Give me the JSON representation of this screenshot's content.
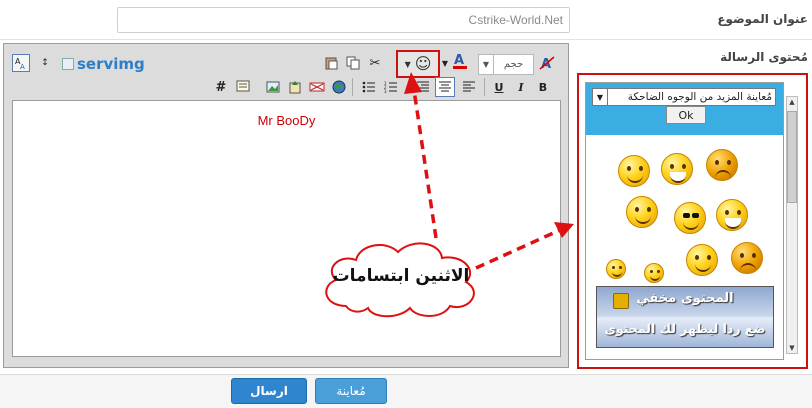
{
  "form": {
    "subject_label": "عنوان الموضوع",
    "subject_value": "Cstrike-World.Net",
    "message_label": "مُحتوى الرسالة"
  },
  "toolbar": {
    "servimg_label": "servimg",
    "size_select_value": "حجم",
    "row1_icons": [
      "font-size-toggle-icon",
      "expand-icon",
      "servimg-icon",
      "paste-icon",
      "copy-icon",
      "cut-icon",
      "smiley-icon",
      "font-color-icon",
      "size-select",
      "strikethrough-icon"
    ],
    "row2_icons": [
      "hash-icon",
      "quote-icon",
      "image-icon",
      "upload-icon",
      "flash-icon",
      "globe-icon",
      "bullet-list-icon",
      "numbered-list-icon",
      "align-right-icon",
      "align-center-icon",
      "align-left-icon",
      "underline-icon",
      "italic-icon",
      "bold-icon"
    ]
  },
  "editor": {
    "content": "Mr BooDy"
  },
  "annotation": {
    "cloud_text": "الاثنين ابتسامات",
    "arrow_color": "#dd1111"
  },
  "smiley_panel": {
    "select_value": "مُعاينة المزيد من الوجوه الضاحكة",
    "ok_label": "Ok",
    "header_color": "#3aaee3",
    "banner_top": "المحتوى مخفي",
    "banner_bottom": "ضع ردا ليظهر لك المحتوى"
  },
  "buttons": {
    "preview": "مُعاينة",
    "send": "ارسال"
  }
}
